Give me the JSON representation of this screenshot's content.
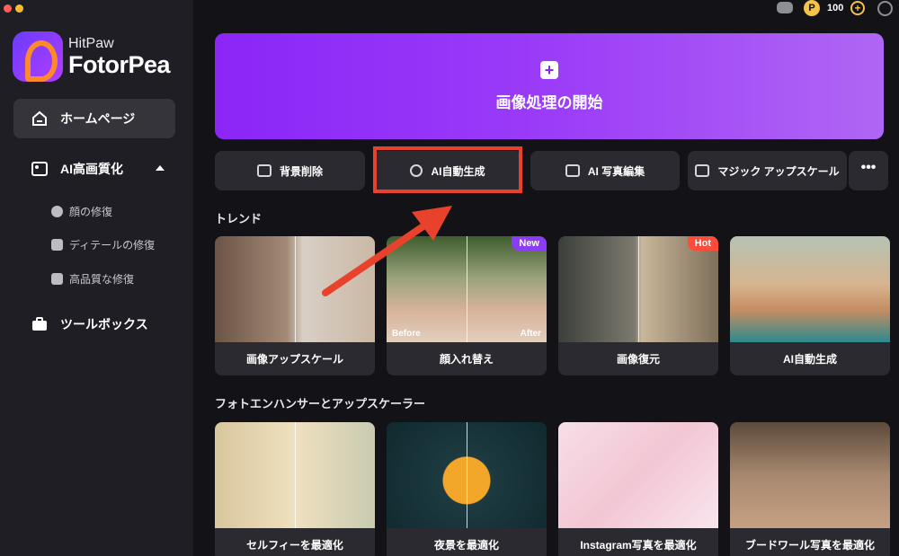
{
  "app": {
    "brand_small": "HitPaw",
    "brand_big": "FotorPea",
    "credits": "100"
  },
  "sidebar": {
    "home": "ホームページ",
    "ai_enhance": "AI高画質化",
    "sub_items": [
      "顔の修復",
      "ディテールの修復",
      "高品質な修復"
    ],
    "toolbox": "ツールボックス"
  },
  "banner": {
    "title": "画像処理の開始"
  },
  "tools": [
    "背景削除",
    "AI自動生成",
    "AI 写真編集",
    "マジック アップスケール"
  ],
  "more": "•••",
  "trend": {
    "title": "トレンド",
    "cards": [
      {
        "label": "画像アップスケール",
        "badge": ""
      },
      {
        "label": "顔入れ替え",
        "badge": "New",
        "before": "Before",
        "after": "After"
      },
      {
        "label": "画像復元",
        "badge": "Hot"
      },
      {
        "label": "AI自動生成",
        "badge": ""
      }
    ]
  },
  "enhancer": {
    "title": "フォトエンハンサーとアップスケーラー",
    "cards": [
      {
        "label": "セルフィーを最適化"
      },
      {
        "label": "夜景を最適化"
      },
      {
        "label": "Instagram写真を最適化"
      },
      {
        "label": "ブードワール写真を最適化"
      }
    ]
  },
  "colors": {
    "accent": "#8b26f7",
    "highlight": "#e8412c",
    "sidebar": "#1f1e24",
    "background": "#131217"
  }
}
